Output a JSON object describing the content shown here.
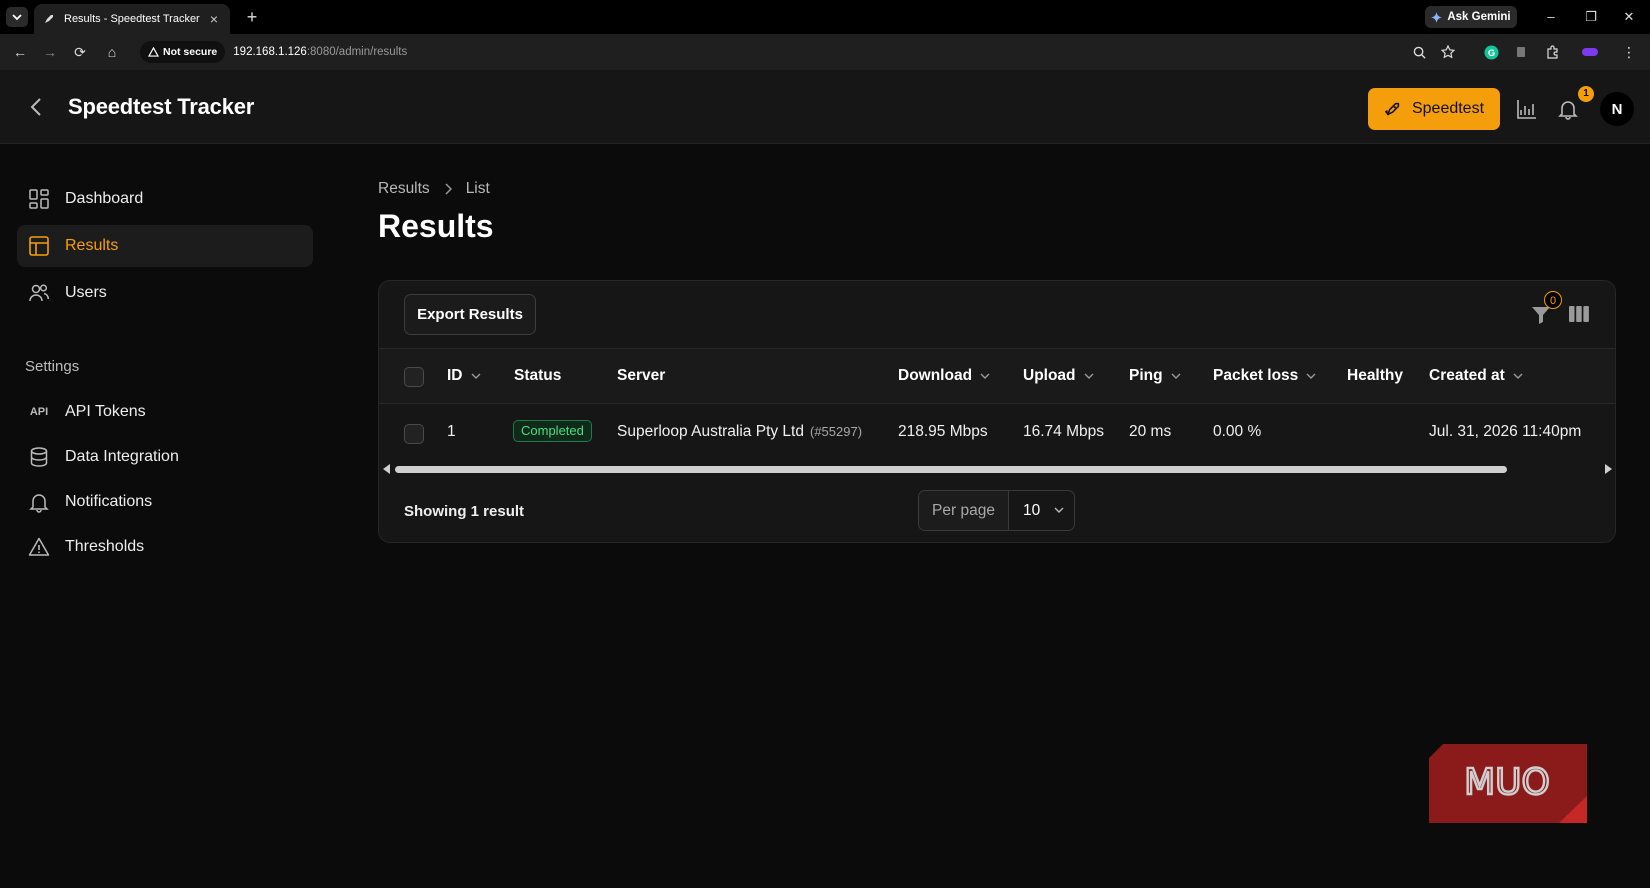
{
  "browser": {
    "tab_title": "Results - Speedtest Tracker",
    "ask_gemini": "Ask Gemini",
    "not_secure": "Not secure",
    "url_host": "192.168.1.126",
    "url_rest": ":8080/admin/results"
  },
  "header": {
    "brand": "Speedtest Tracker",
    "speedtest_button": "Speedtest",
    "notification_count": "1",
    "avatar_initial": "N",
    "accent_color": "#f59e0b"
  },
  "sidebar": {
    "items": [
      {
        "label": "Dashboard",
        "icon": "dashboard-grid-icon"
      },
      {
        "label": "Results",
        "icon": "table-icon",
        "active": true
      },
      {
        "label": "Users",
        "icon": "users-icon"
      }
    ],
    "settings_label": "Settings",
    "settings_items": [
      {
        "label": "API Tokens",
        "icon": "api-icon",
        "icon_text": "API"
      },
      {
        "label": "Data Integration",
        "icon": "database-icon"
      },
      {
        "label": "Notifications",
        "icon": "bell-icon"
      },
      {
        "label": "Thresholds",
        "icon": "warning-icon"
      }
    ]
  },
  "main": {
    "breadcrumb": [
      "Results",
      "List"
    ],
    "title": "Results",
    "export_button": "Export Results",
    "filter_count": "0",
    "columns": [
      "ID",
      "Status",
      "Server",
      "Download",
      "Upload",
      "Ping",
      "Packet loss",
      "Healthy",
      "Created at"
    ],
    "rows": [
      {
        "id": "1",
        "status": "Completed",
        "server": "Superloop Australia Pty Ltd",
        "server_id": "(#55297)",
        "download": "218.95 Mbps",
        "upload": "16.74 Mbps",
        "ping": "20 ms",
        "packet_loss": "0.00 %",
        "healthy": "",
        "created_at": "Jul. 31, 2026 11:40pm"
      }
    ],
    "showing": "Showing 1 result",
    "per_page_label": "Per page",
    "per_page_value": "10"
  },
  "watermark": "MUO"
}
